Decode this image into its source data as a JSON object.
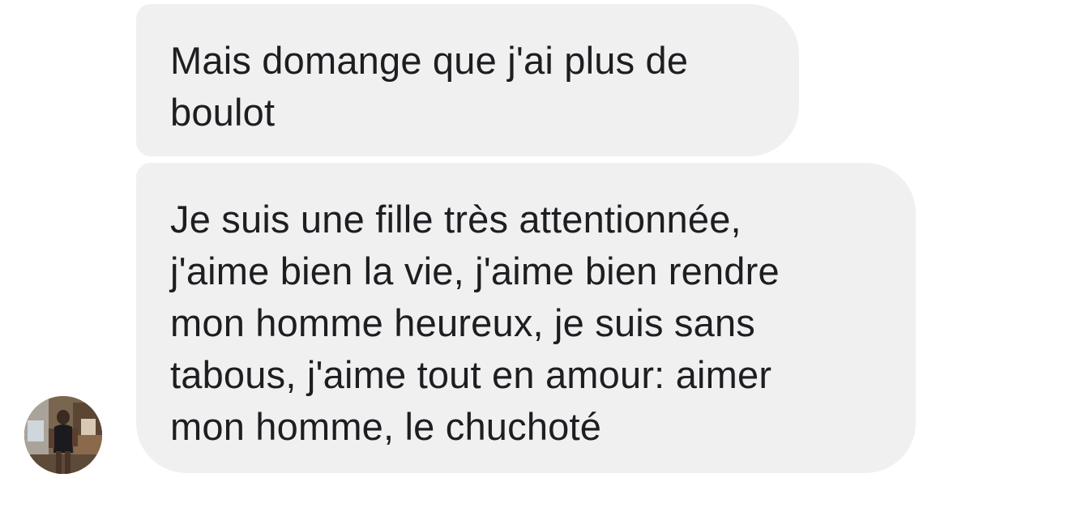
{
  "conversation": {
    "messages": [
      {
        "lines": [
          "Mais domange que j'ai plus de",
          "boulot"
        ]
      },
      {
        "lines": [
          "Je suis une fille très attentionnée,",
          "j'aime bien la vie, j'aime bien rendre",
          "mon homme heureux, je suis sans",
          "tabous, j'aime tout en amour: aimer",
          "mon homme, le chuchoté"
        ]
      }
    ],
    "sender_avatar": {
      "icon": "profile-photo",
      "ring_color": "#d9d3cc"
    },
    "bubble_color": "#f1f0f0",
    "text_color": "#1c1e21"
  }
}
